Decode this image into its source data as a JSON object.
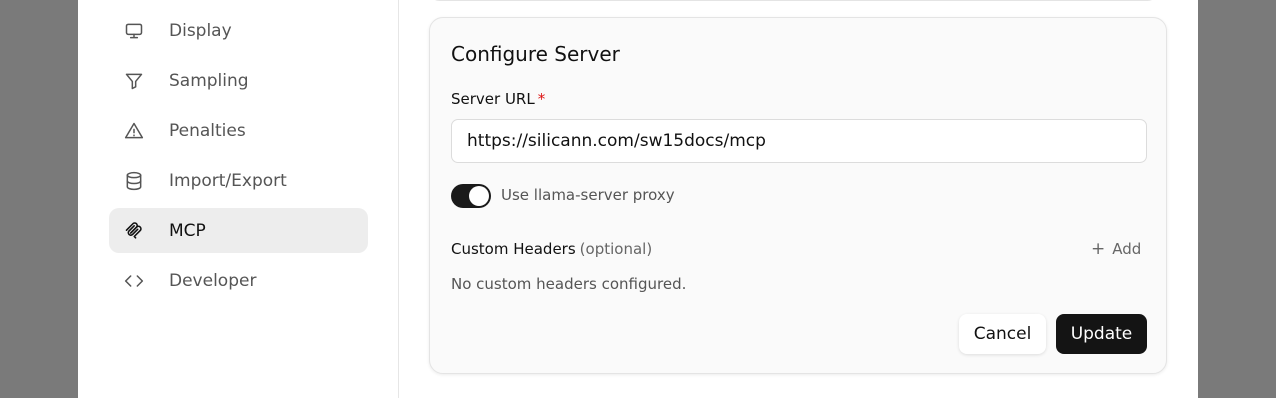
{
  "sidebar": {
    "items": [
      {
        "label": "Display",
        "icon": "monitor-icon",
        "active": false
      },
      {
        "label": "Sampling",
        "icon": "funnel-icon",
        "active": false
      },
      {
        "label": "Penalties",
        "icon": "warning-triangle-icon",
        "active": false
      },
      {
        "label": "Import/Export",
        "icon": "database-icon",
        "active": false
      },
      {
        "label": "MCP",
        "icon": "mcp-icon",
        "active": true
      },
      {
        "label": "Developer",
        "icon": "code-icon",
        "active": false
      }
    ]
  },
  "card": {
    "title": "Configure Server",
    "server_url_label": "Server URL",
    "required_marker": "*",
    "server_url_value": "https://silicann.com/sw15docs/mcp",
    "proxy_toggle_label": "Use llama-server proxy",
    "proxy_enabled": true,
    "custom_headers_label": "Custom Headers",
    "custom_headers_optional": "(optional)",
    "add_label": "Add",
    "add_icon": "plus-icon",
    "empty_headers_text": "No custom headers configured.",
    "cancel_label": "Cancel",
    "update_label": "Update"
  },
  "colors": {
    "accent": "#141414",
    "required": "#dd1111",
    "active_nav_bg": "#ededed",
    "overlay": "#7a7a7a"
  }
}
